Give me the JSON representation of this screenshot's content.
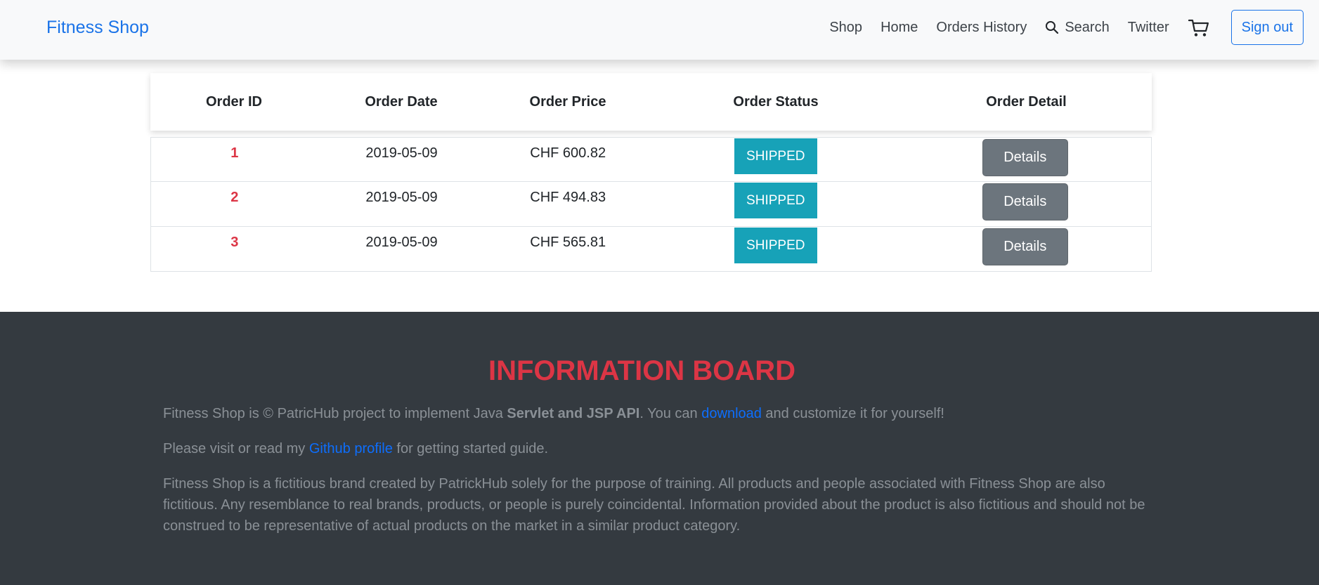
{
  "nav": {
    "brand": "Fitness Shop",
    "links": [
      "Shop",
      "Home",
      "Orders History",
      "Search",
      "Twitter"
    ],
    "sign_out": "Sign out"
  },
  "table": {
    "headers": [
      "Order ID",
      "Order Date",
      "Order Price",
      "Order Status",
      "Order Detail"
    ],
    "rows": [
      {
        "id": "1",
        "date": "2019-05-09",
        "price": "CHF 600.82",
        "status": "SHIPPED",
        "detail": "Details"
      },
      {
        "id": "2",
        "date": "2019-05-09",
        "price": "CHF 494.83",
        "status": "SHIPPED",
        "detail": "Details"
      },
      {
        "id": "3",
        "date": "2019-05-09",
        "price": "CHF 565.81",
        "status": "SHIPPED",
        "detail": "Details"
      }
    ]
  },
  "footer": {
    "title": "INFORMATION BOARD",
    "p1_a": "Fitness Shop is © PatricHub project to implement Java ",
    "p1_bold": "Servlet and JSP API",
    "p1_b": ". You can ",
    "p1_link": "download",
    "p1_c": " and customize it for yourself!",
    "p2_a": "Please visit or read my ",
    "p2_link": "Github profile",
    "p2_b": " for getting started guide.",
    "p3": "Fitness Shop is a fictitious brand created by PatrickHub solely for the purpose of training. All products and people associated with Fitness Shop are also fictitious. Any resemblance to real brands, products, or people is purely coincidental. Information provided about the product is also fictitious and should not be construed to be representative of actual products on the market in a similar product category."
  },
  "colors": {
    "brand": "#1a73e8",
    "status": "#17a2b8",
    "details": "#6c757d",
    "footer_bg": "#343a40",
    "accent_red": "#dc3545"
  },
  "icons": {
    "search": "search-icon",
    "cart": "cart-icon"
  }
}
